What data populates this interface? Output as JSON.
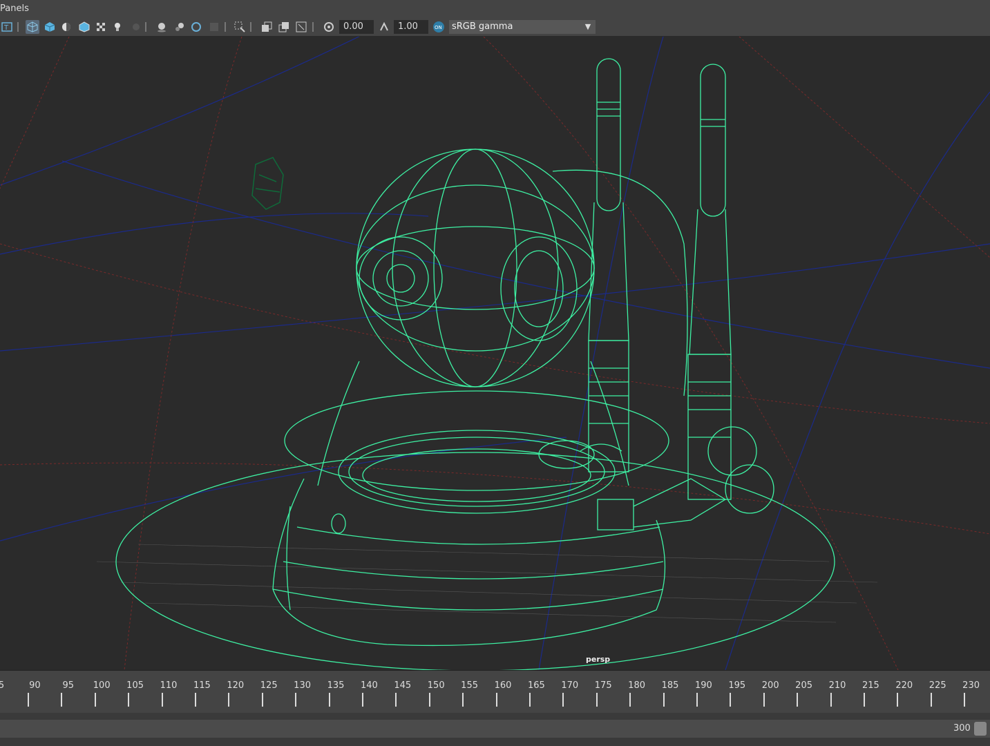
{
  "menubar": {
    "panels_label": "Panels"
  },
  "toolbar": {
    "exposure_value": "0.00",
    "gamma_value": "1.00",
    "color_space": "sRGB gamma",
    "icons": [
      "camera-attr-icon",
      "wireframe-icon",
      "smooth-shade-icon",
      "shade-default-icon",
      "textured-icon",
      "use-lights-icon",
      "shadows-icon",
      "ambient-occlusion-icon",
      "motion-blur-icon",
      "multisample-icon",
      "depth-of-field-icon",
      "isolate-select-icon",
      "xray-icon",
      "xray-joints-icon",
      "xray-active-icon",
      "exposure-icon",
      "gamma-icon",
      "color-management-icon"
    ]
  },
  "viewport": {
    "camera_name": "persp"
  },
  "timeline": {
    "frames": [
      "5",
      "90",
      "95",
      "100",
      "105",
      "110",
      "115",
      "120",
      "125",
      "130",
      "135",
      "140",
      "145",
      "150",
      "155",
      "160",
      "165",
      "170",
      "175",
      "180",
      "185",
      "190",
      "195",
      "200",
      "205",
      "210",
      "215",
      "220",
      "225",
      "230"
    ]
  },
  "range": {
    "end_value": "300"
  },
  "colors": {
    "wire": "#3ef2a4",
    "grid_blue": "#1b2a8a",
    "grid_red": "#7a2a2a",
    "viewport_bg": "#2b2b2b"
  }
}
